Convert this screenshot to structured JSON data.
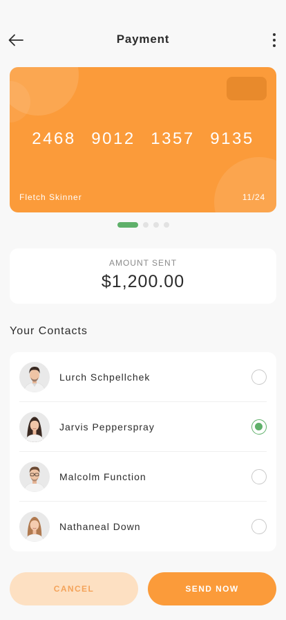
{
  "header": {
    "title": "Payment",
    "back_icon": "arrow-left-icon",
    "more_icon": "more-vertical-icon"
  },
  "card": {
    "number_groups": [
      "2468",
      "9012",
      "1357",
      "9135"
    ],
    "holder": "Fletch Skinner",
    "expiry": "11/24",
    "color": "#fb9b3a"
  },
  "pager": {
    "total": 4,
    "active_index": 0
  },
  "amount": {
    "label": "AMOUNT SENT",
    "value": "$1,200.00"
  },
  "contacts": {
    "title": "Your Contacts",
    "items": [
      {
        "name": "Lurch Schpellchek",
        "selected": false
      },
      {
        "name": "Jarvis Pepperspray",
        "selected": true
      },
      {
        "name": "Malcolm Function",
        "selected": false
      },
      {
        "name": "Nathaneal Down",
        "selected": false
      }
    ]
  },
  "actions": {
    "cancel_label": "CANCEL",
    "send_label": "SEND NOW"
  },
  "colors": {
    "accent": "#fb9b3a",
    "selected": "#5fb06a"
  }
}
